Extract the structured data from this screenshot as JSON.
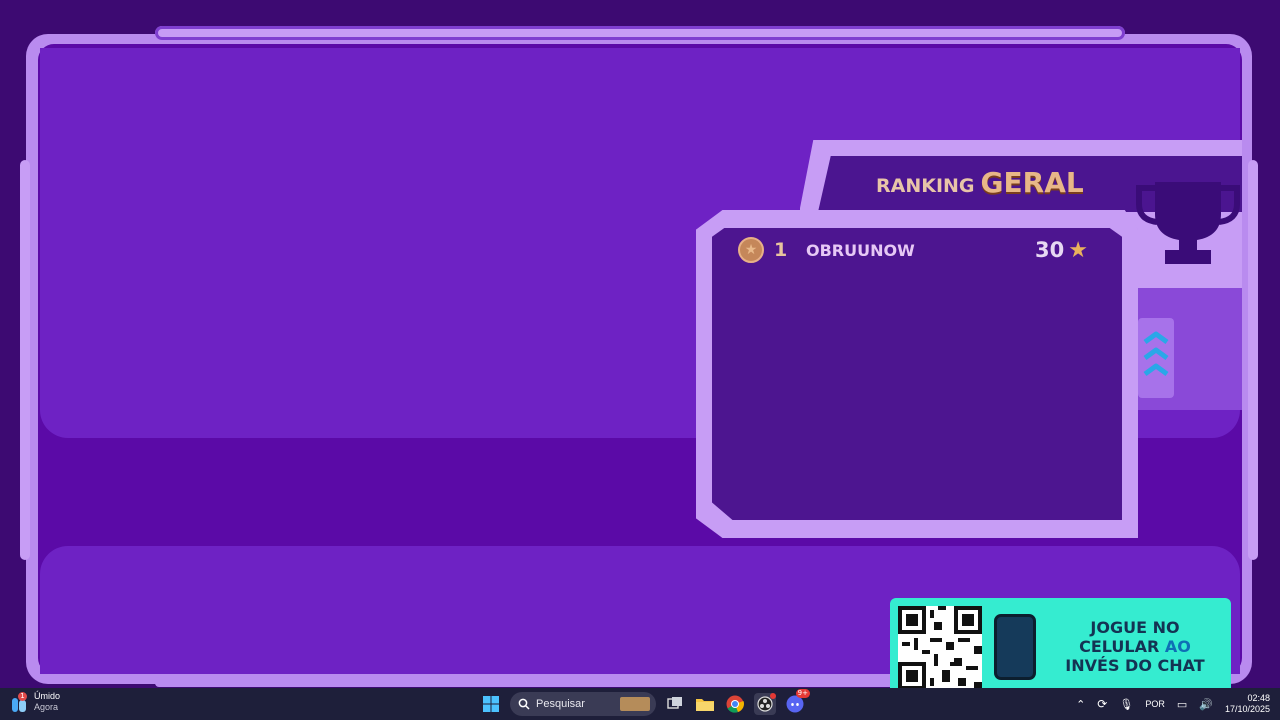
{
  "ranking": {
    "title_part1": "RANKING",
    "title_part2": "GERAL",
    "entries": [
      {
        "position": "1",
        "name": "OBRUUNOW",
        "score": "30"
      }
    ]
  },
  "promo": {
    "line1": "JOGUE NO",
    "line2a": "CELULAR",
    "line2b": "AO",
    "line3": "INVÉS DO CHAT"
  },
  "taskbar": {
    "weather_label": "Úmido",
    "weather_sub": "Agora",
    "weather_badge": "1",
    "search_placeholder": "Pesquisar",
    "language": "POR",
    "time": "02:48",
    "date": "17/10/2025",
    "discord_badge": "9+"
  },
  "colors": {
    "background": "#3d0a72",
    "panel": "#6e22c4",
    "frame": "#b98bef",
    "accent_gold": "#e8b788",
    "promo_bg": "#35ecd0"
  },
  "icons": [
    "medal-icon",
    "star-icon",
    "trophy-icon",
    "chevron-up-icon",
    "qr-code",
    "phone-icon",
    "windows-start-icon",
    "search-icon",
    "file-explorer-icon",
    "chrome-icon",
    "discord-icon"
  ]
}
